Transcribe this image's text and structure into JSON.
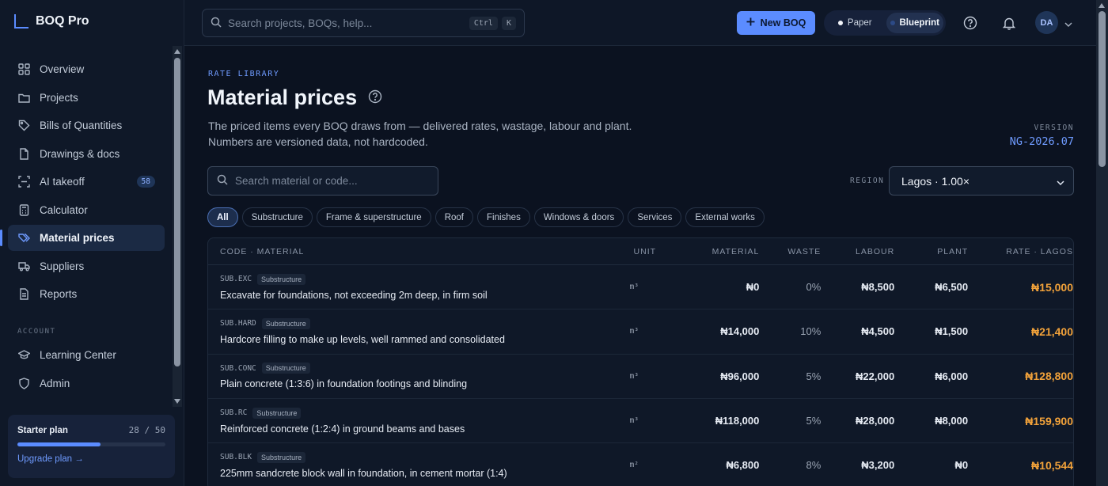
{
  "brand": {
    "name": "BOQ Pro"
  },
  "sidebar": {
    "items": [
      {
        "label": "Overview",
        "icon": "grid-icon"
      },
      {
        "label": "Projects",
        "icon": "folder-icon"
      },
      {
        "label": "Bills of Quantities",
        "icon": "tag-icon"
      },
      {
        "label": "Drawings & docs",
        "icon": "file-icon"
      },
      {
        "label": "AI takeoff",
        "icon": "scan-icon",
        "badge": "58"
      },
      {
        "label": "Calculator",
        "icon": "calculator-icon"
      },
      {
        "label": "Material prices",
        "icon": "price-tags-icon",
        "active": true
      },
      {
        "label": "Suppliers",
        "icon": "truck-icon"
      },
      {
        "label": "Reports",
        "icon": "report-icon"
      }
    ],
    "section_label": "ACCOUNT",
    "account_items": [
      {
        "label": "Learning Center",
        "icon": "graduation-cap-icon"
      },
      {
        "label": "Admin",
        "icon": "shield-icon"
      }
    ],
    "plan": {
      "name": "Starter plan",
      "count": "28 / 50",
      "used": 28,
      "limit": 50,
      "upgrade": "Upgrade plan →"
    }
  },
  "topbar": {
    "search_placeholder": "Search projects, BOQs, help...",
    "kbd1": "Ctrl",
    "kbd2": "K",
    "new_boq": "New BOQ",
    "mode_paper": "Paper",
    "mode_blueprint": "Blueprint",
    "avatar": "DA"
  },
  "page": {
    "eyebrow": "RATE LIBRARY",
    "title": "Material prices",
    "desc1": "The priced items every BOQ draws from — delivered rates, wastage, labour and plant.",
    "desc2": "Numbers are versioned data, not hardcoded.",
    "version_label": "VERSION",
    "version_value": "NG-2026.07",
    "search_placeholder": "Search material or code...",
    "region_label": "REGION",
    "region_value": "Lagos · 1.00×"
  },
  "chips": [
    "All",
    "Substructure",
    "Frame & superstructure",
    "Roof",
    "Finishes",
    "Windows & doors",
    "Services",
    "External works"
  ],
  "table": {
    "headers": {
      "code": "CODE · MATERIAL",
      "unit": "UNIT",
      "material": "MATERIAL",
      "waste": "WASTE",
      "labour": "LABOUR",
      "plant": "PLANT",
      "rate": "RATE · LAGOS"
    },
    "rows": [
      {
        "code": "SUB.EXC",
        "cat": "Substructure",
        "name": "Excavate for foundations, not exceeding 2m deep, in firm soil",
        "unit": "m³",
        "material": "₦0",
        "waste": "0%",
        "labour": "₦8,500",
        "plant": "₦6,500",
        "rate": "₦15,000"
      },
      {
        "code": "SUB.HARD",
        "cat": "Substructure",
        "name": "Hardcore filling to make up levels, well rammed and consolidated",
        "unit": "m³",
        "material": "₦14,000",
        "waste": "10%",
        "labour": "₦4,500",
        "plant": "₦1,500",
        "rate": "₦21,400"
      },
      {
        "code": "SUB.CONC",
        "cat": "Substructure",
        "name": "Plain concrete (1:3:6) in foundation footings and blinding",
        "unit": "m³",
        "material": "₦96,000",
        "waste": "5%",
        "labour": "₦22,000",
        "plant": "₦6,000",
        "rate": "₦128,800"
      },
      {
        "code": "SUB.RC",
        "cat": "Substructure",
        "name": "Reinforced concrete (1:2:4) in ground beams and bases",
        "unit": "m³",
        "material": "₦118,000",
        "waste": "5%",
        "labour": "₦28,000",
        "plant": "₦8,000",
        "rate": "₦159,900"
      },
      {
        "code": "SUB.BLK",
        "cat": "Substructure",
        "name": "225mm sandcrete block wall in foundation, in cement mortar (1:4)",
        "unit": "m²",
        "material": "₦6,800",
        "waste": "8%",
        "labour": "₦3,200",
        "plant": "₦0",
        "rate": "₦10,544"
      }
    ]
  },
  "colors": {
    "accent": "#5b8cff",
    "rate": "#f2a23a",
    "background": "#0b1220"
  }
}
